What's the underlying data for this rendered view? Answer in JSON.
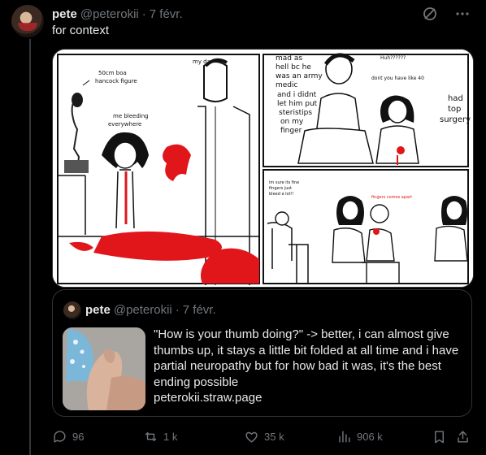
{
  "tweet": {
    "author_name": "pete",
    "author_handle": "@peterokii",
    "separator": "·",
    "date": "7 févr.",
    "text": "for context"
  },
  "comic": {
    "panel1": {
      "label_figure": [
        "50cm boa",
        "hancock figure"
      ],
      "label_bleeding": [
        "me bleeding",
        "everywhere"
      ],
      "label_dad": "my dad"
    },
    "panel2": {
      "text_left": [
        "mad as",
        "hell bc he",
        "was an army",
        "medic",
        "and i didnt",
        "let him put",
        "steristips",
        "on my",
        "finger"
      ],
      "huh": "Huh??????",
      "dont": "dont you have like 40",
      "had": [
        "had",
        "top",
        "surgery"
      ]
    },
    "panel3": {
      "small_text": [
        "im sure its fine",
        "fingers just",
        "bleed a lot!!"
      ],
      "fingers_text": "fingers comes apart"
    }
  },
  "quote": {
    "author_name": "pete",
    "author_handle": "@peterokii",
    "separator": "·",
    "date": "7 févr.",
    "body": "\"How is your thumb doing?\" -> better, i can almost give thumbs up, it stays a little bit folded at all time and i have partial neuropathy but for how bad it was, it's the best ending possible",
    "link": "peterokii.straw.page"
  },
  "actions": {
    "replies": "96",
    "reposts": "1 k",
    "likes": "35 k",
    "views": "906 k"
  },
  "colors": {
    "background": "#000000",
    "text": "#e7e9ea",
    "muted": "#71767b",
    "border": "#2f3336",
    "blood": "#e0161b"
  },
  "icons": [
    "grok-icon",
    "more-icon",
    "reply-icon",
    "repost-icon",
    "like-icon",
    "views-icon",
    "bookmark-icon",
    "share-icon"
  ]
}
